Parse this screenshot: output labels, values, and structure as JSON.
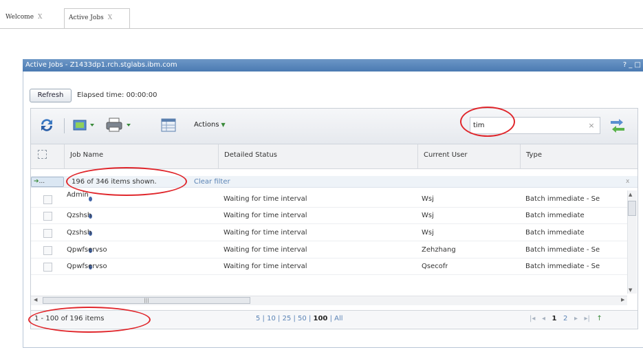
{
  "tabs": [
    {
      "label": "Welcome",
      "close": "X"
    },
    {
      "label": "Active Jobs",
      "close": "X"
    }
  ],
  "panel": {
    "title": "Active Jobs - Z1433dp1.rch.stglabs.ibm.com",
    "title_buttons": "? _ □"
  },
  "refresh_label": "Refresh",
  "elapsed_time": "Elapsed time: 00:00:00",
  "toolbar": {
    "actions_label": "Actions",
    "filter_value": "tim",
    "clear_glyph": "×"
  },
  "columns": [
    "Job Name",
    "Detailed Status",
    "Current User",
    "Type"
  ],
  "filter_row": {
    "button_label": "...",
    "items_shown": "196 of 346 items shown.",
    "clear_filter": "Clear filter",
    "close": "x"
  },
  "rows": [
    {
      "name": "Admin",
      "status": "Waiting for time interval",
      "user": "Wsj",
      "type": "Batch immediate - Se"
    },
    {
      "name": "Qzshsh",
      "status": "Waiting for time interval",
      "user": "Wsj",
      "type": "Batch immediate"
    },
    {
      "name": "Qzshsh",
      "status": "Waiting for time interval",
      "user": "Wsj",
      "type": "Batch immediate"
    },
    {
      "name": "Qpwfservso",
      "status": "Waiting for time interval",
      "user": "Zehzhang",
      "type": "Batch immediate - Se"
    },
    {
      "name": "Qpwfservso",
      "status": "Waiting for time interval",
      "user": "Qsecofr",
      "type": "Batch immediate - Se"
    }
  ],
  "footer": {
    "range": "1 - 100 of 196 items",
    "page_sizes": [
      "5",
      "10",
      "25",
      "50",
      "100",
      "All"
    ],
    "selected_page_size": "100",
    "pages": [
      "1",
      "2"
    ],
    "current_page": "1"
  },
  "colors": {
    "title_bar": "#4a7ab2",
    "annotation": "#e0262b",
    "link": "#5a83b5"
  },
  "icons": [
    "refresh-icon",
    "export-icon",
    "print-icon",
    "table-view-icon",
    "filter-go-icon"
  ]
}
